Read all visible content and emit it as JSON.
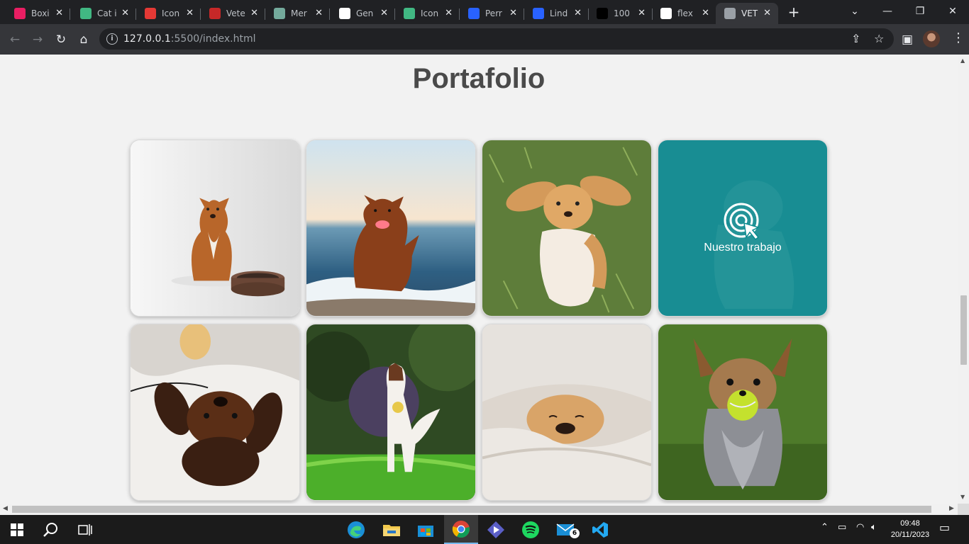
{
  "browser": {
    "tabs": [
      {
        "title": "Boxi",
        "icon": "boxicons-icon",
        "color": "#e91e63"
      },
      {
        "title": "Cat i",
        "icon": "vue-icon",
        "color": "#41b883"
      },
      {
        "title": "Icon",
        "icon": "icon-site-icon",
        "color": "#e53935"
      },
      {
        "title": "Vete",
        "icon": "vet-icon",
        "color": "#c62828"
      },
      {
        "title": "Mer",
        "icon": "chatgpt-icon",
        "color": "#74aa9c"
      },
      {
        "title": "Gen",
        "icon": "generator-icon",
        "color": "#ffffff"
      },
      {
        "title": "Icon",
        "icon": "vue-icon",
        "color": "#41b883"
      },
      {
        "title": "Perr",
        "icon": "flaticon-icon",
        "color": "#2962ff"
      },
      {
        "title": "Lind",
        "icon": "flaticon-icon",
        "color": "#2962ff"
      },
      {
        "title": "100",
        "icon": "unsplash-icon",
        "color": "#000000"
      },
      {
        "title": "flex",
        "icon": "google-icon",
        "color": "#ffffff"
      },
      {
        "title": "VET",
        "icon": "globe-icon",
        "color": "#9aa0a6",
        "active": true
      }
    ],
    "url_host": "127.0.0.1",
    "url_rest": ":5500/index.html"
  },
  "page": {
    "title": "Portafolio",
    "overlay_label": "Nuestro trabajo",
    "gallery": [
      {
        "alt": "toller dog with bowl"
      },
      {
        "alt": "dog running on beach"
      },
      {
        "alt": "cocker puppy on grass"
      },
      {
        "alt": "puppy with overlay"
      },
      {
        "alt": "dachshund on blanket"
      },
      {
        "alt": "border collie with ball"
      },
      {
        "alt": "puppy in bed"
      },
      {
        "alt": "yorkshire with tennis ball"
      }
    ]
  },
  "taskbar": {
    "time": "09:48",
    "date": "20/11/2023",
    "mail_badge": "6",
    "accent": "#76b9ed"
  }
}
